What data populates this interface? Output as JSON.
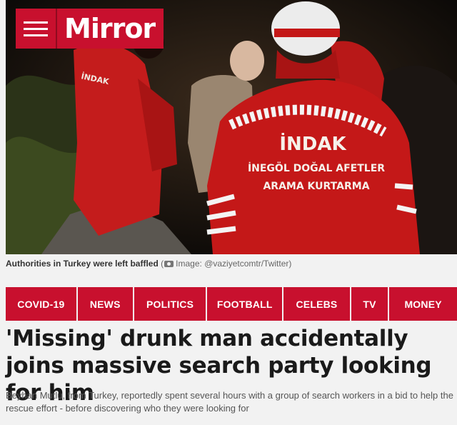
{
  "logo": {
    "wordmark": "Mirror"
  },
  "hero": {
    "jacket_text_line1": "İNDAK",
    "jacket_text_line2": "İNEGÖL DOĞAL AFETLER",
    "jacket_text_line3": "ARAMA KURTARMA",
    "sleeve_text": "İNDAK"
  },
  "caption": {
    "text": "Authorities in Turkey were left baffled",
    "credit_open": "(",
    "credit": "Image: @vaziyetcomtr/Twitter)"
  },
  "nav": {
    "items": [
      {
        "label": "COVID-19"
      },
      {
        "label": "NEWS"
      },
      {
        "label": "POLITICS"
      },
      {
        "label": "FOOTBALL"
      },
      {
        "label": "CELEBS"
      },
      {
        "label": "TV"
      },
      {
        "label": "MONEY"
      }
    ]
  },
  "article": {
    "headline": "'Missing' drunk man accidentally joins massive search party looking for him",
    "standfirst": "Beyhan Mutlu, from Turkey, reportedly spent several hours with a group of search workers in a bid to help the rescue effort - before discovering who they were looking for"
  },
  "colors": {
    "brand_red": "#c8102e",
    "background": "#f2f2f2",
    "headline": "#1a1a1a"
  }
}
